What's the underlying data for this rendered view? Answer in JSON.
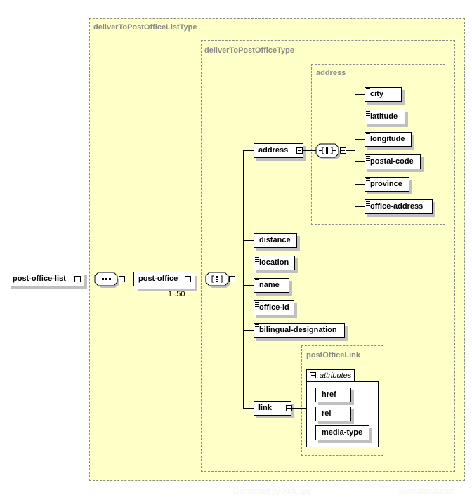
{
  "groups": {
    "list_type": "deliverToPostOfficeListType",
    "office_type": "deliverToPostOfficeType",
    "address_type": "address",
    "link_type": "postOfficeLink"
  },
  "root": {
    "label": "post-office-list"
  },
  "post_office": {
    "label": "post-office",
    "cardinality": "1..50"
  },
  "compositors": {
    "outer": "sequence",
    "inner": "all",
    "address": "all"
  },
  "office_children": [
    {
      "label": "address",
      "kind": "complex"
    },
    {
      "label": "distance",
      "kind": "simple"
    },
    {
      "label": "location",
      "kind": "simple"
    },
    {
      "label": "name",
      "kind": "simple"
    },
    {
      "label": "office-id",
      "kind": "simple"
    },
    {
      "label": "bilingual-designation",
      "kind": "simple"
    },
    {
      "label": "link",
      "kind": "complex"
    }
  ],
  "address_children": [
    "city",
    "latitude",
    "longitude",
    "postal-code",
    "province",
    "office-address"
  ],
  "link_attributes": {
    "header": "attributes",
    "items": [
      "href",
      "rel",
      "media-type"
    ]
  },
  "watermark": {
    "left": "Generated by XMLSpy",
    "right": "www.altova.com"
  }
}
